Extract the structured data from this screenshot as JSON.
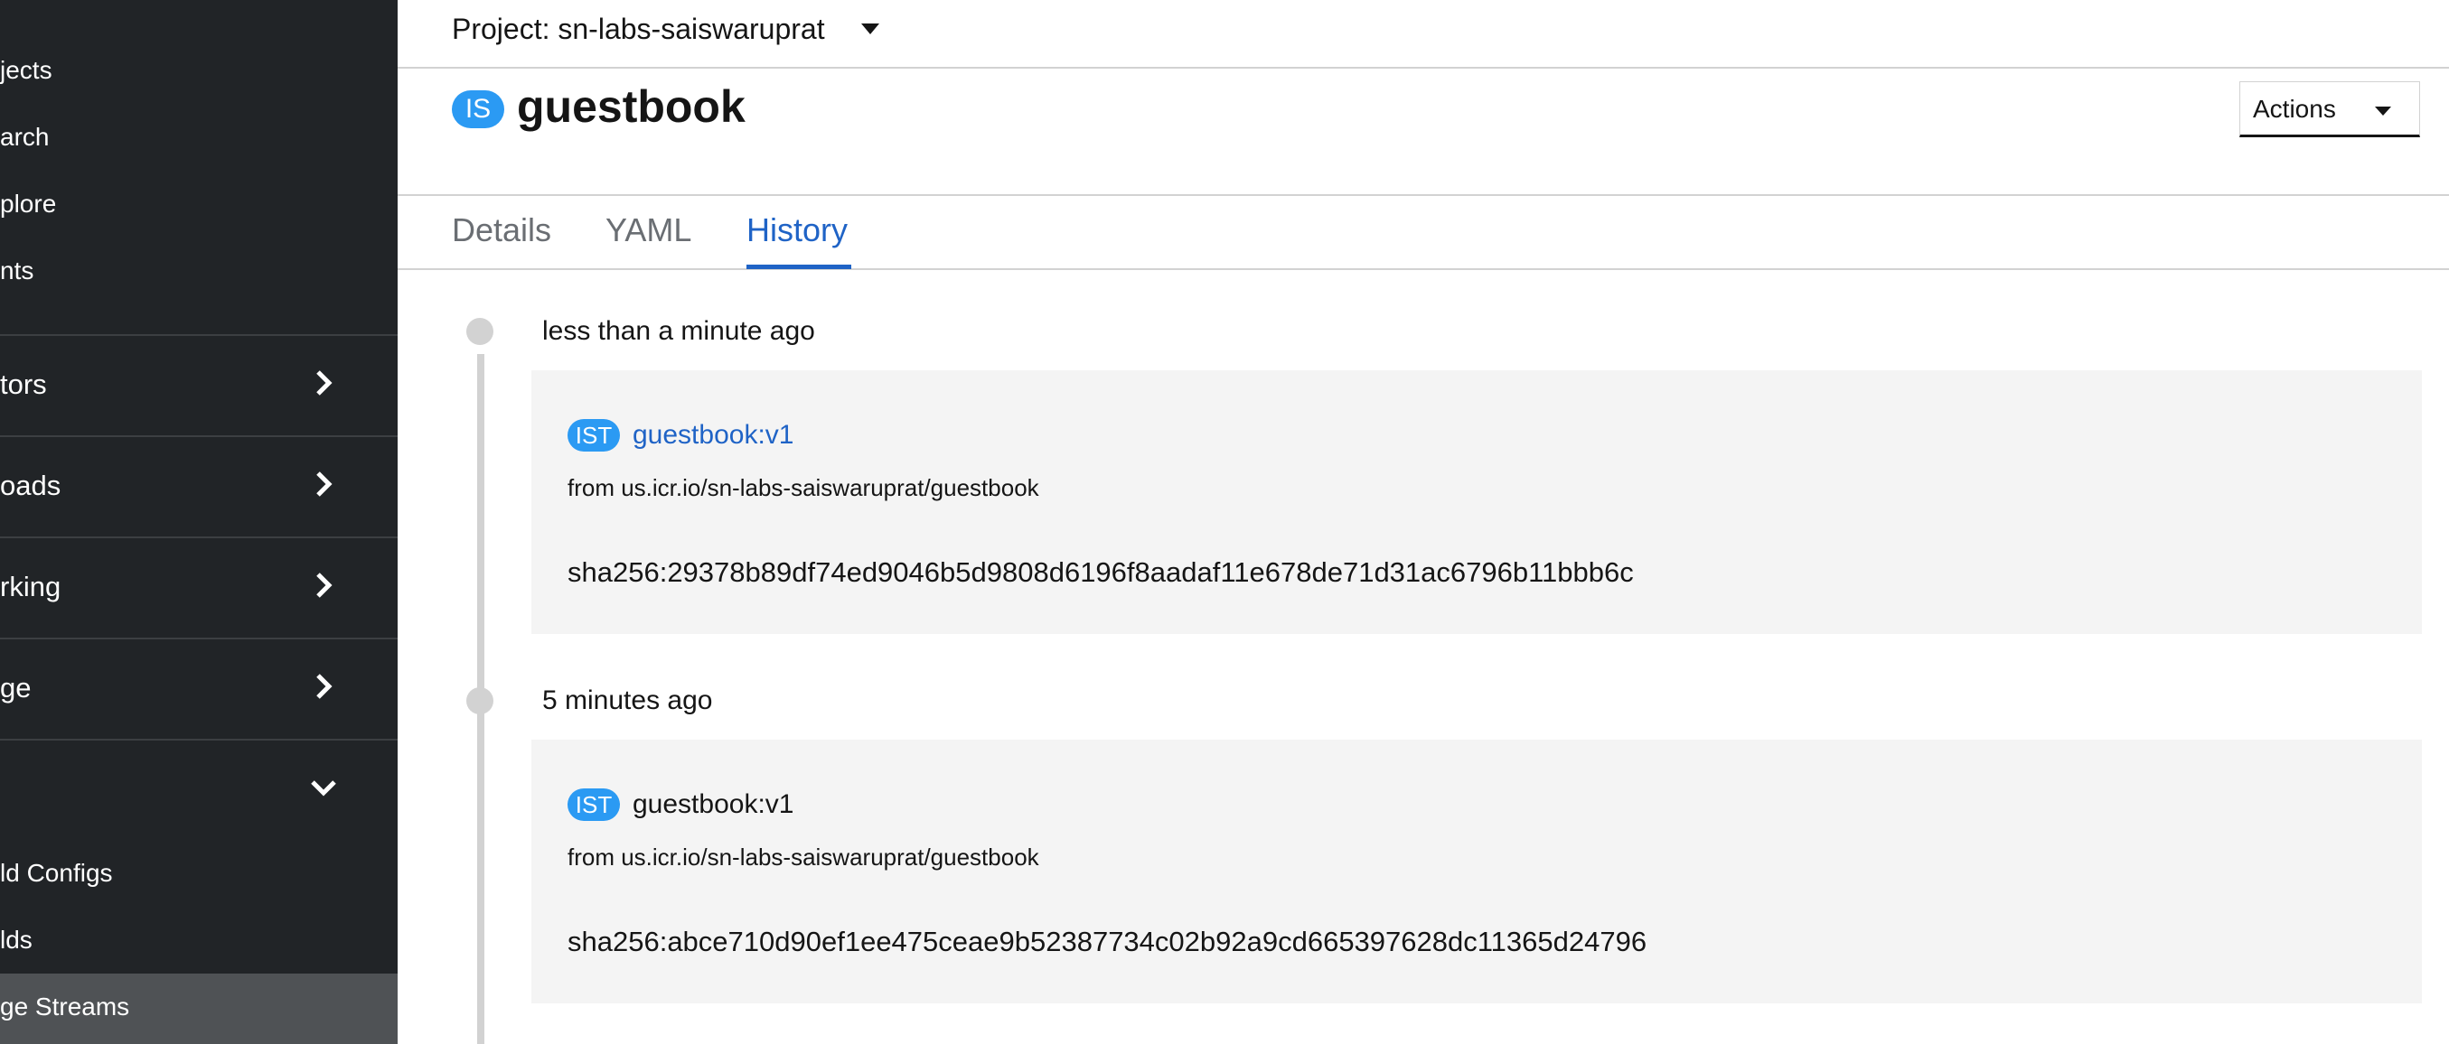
{
  "sidebar": {
    "links_top": [
      "jects",
      "arch",
      "plore",
      "nts"
    ],
    "sections": [
      "tors",
      "oads",
      "rking",
      "ge",
      ""
    ],
    "links_bottom": [
      "ld Configs",
      "lds",
      "ge Streams"
    ]
  },
  "project": {
    "label": "Project: sn-labs-saiswaruprat"
  },
  "header": {
    "kind_badge": "IS",
    "title": "guestbook",
    "actions_label": "Actions"
  },
  "tabs": [
    {
      "label": "Details",
      "active": false
    },
    {
      "label": "YAML",
      "active": false
    },
    {
      "label": "History",
      "active": true
    }
  ],
  "history": [
    {
      "time": "less than a minute ago",
      "badge": "IST",
      "tag": "guestbook:v1",
      "from": "from us.icr.io/sn-labs-saiswaruprat/guestbook",
      "sha": "sha256:29378b89df74ed9046b5d9808d6196f8aadaf11e678de71d31ac6796b11bbb6c"
    },
    {
      "time": "5 minutes ago",
      "badge": "IST",
      "tag": "guestbook:v1",
      "from": "from us.icr.io/sn-labs-saiswaruprat/guestbook",
      "sha": "sha256:abce710d90ef1ee475ceae9b52387734c02b92a9cd665397628dc11365d24796"
    }
  ],
  "colors": {
    "accent": "#1f63c6",
    "badge": "#2b9af3",
    "sidebar": "#212427"
  }
}
